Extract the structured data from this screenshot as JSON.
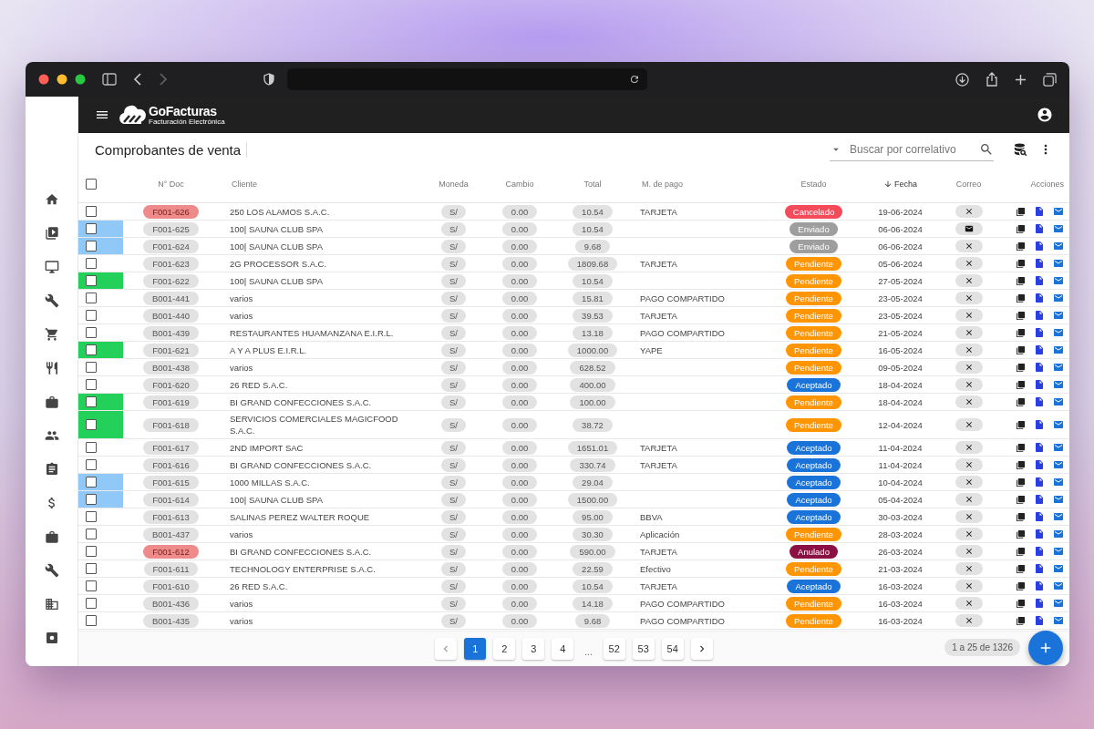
{
  "app": {
    "logo_title": "GoFacturas",
    "logo_subtitle": "Facturación Electrónica"
  },
  "page": {
    "title": "Comprobantes de venta",
    "search": {
      "placeholder": "Buscar por correlativo"
    }
  },
  "table": {
    "columns": [
      "N° Doc",
      "Cliente",
      "Moneda",
      "Cambio",
      "Total",
      "M. de pago",
      "Estado",
      "Fecha",
      "Correo",
      "Acciones"
    ],
    "select_all_checked": false,
    "rows": [
      {
        "doc": "F001-626",
        "checked": false,
        "flagged": true,
        "client": "250 LOS ALAMOS S.A.C.",
        "currency": "S/",
        "rate": "0.00",
        "total": "10.54",
        "payment": "TARJETA",
        "status": {
          "label": "Cancelado",
          "color": "#f44a5a"
        },
        "date": "19-06-2024",
        "email_sent": false
      },
      {
        "doc": "F001-625",
        "checked": false,
        "flagged": false,
        "client": "100| SAUNA CLUB SPA",
        "currency": "S/",
        "rate": "0.00",
        "total": "10.54",
        "status": {
          "label": "Enviado",
          "color": "#9e9e9e"
        },
        "date": "06-06-2024",
        "email_sent": true,
        "color": "#90c8f8"
      },
      {
        "doc": "F001-624",
        "checked": false,
        "flagged": false,
        "client": "100| SAUNA CLUB SPA",
        "currency": "S/",
        "rate": "0.00",
        "total": "9.68",
        "status": {
          "label": "Enviado",
          "color": "#9e9e9e"
        },
        "date": "06-06-2024",
        "email_sent": false,
        "color": "#90c8f8"
      },
      {
        "doc": "F001-623",
        "checked": false,
        "flagged": false,
        "client": "2G PROCESSOR S.A.C.",
        "currency": "S/",
        "rate": "0.00",
        "total": "1809.68",
        "payment": "TARJETA",
        "status": {
          "label": "Pendiente",
          "color": "#ff9500"
        },
        "date": "05-06-2024",
        "email_sent": false
      },
      {
        "doc": "F001-622",
        "checked": false,
        "flagged": false,
        "client": "100| SAUNA CLUB SPA",
        "currency": "S/",
        "rate": "0.00",
        "total": "10.54",
        "status": {
          "label": "Pendiente",
          "color": "#ff9500"
        },
        "date": "27-05-2024",
        "email_sent": false,
        "color": "#22d05a"
      },
      {
        "doc": "B001-441",
        "checked": false,
        "flagged": false,
        "client": "varios",
        "currency": "S/",
        "rate": "0.00",
        "total": "15.81",
        "payment": "PAGO COMPARTIDO",
        "status": {
          "label": "Pendiente",
          "color": "#ff9500"
        },
        "date": "23-05-2024",
        "email_sent": false
      },
      {
        "doc": "B001-440",
        "checked": false,
        "flagged": false,
        "client": "varios",
        "currency": "S/",
        "rate": "0.00",
        "total": "39.53",
        "payment": "TARJETA",
        "status": {
          "label": "Pendiente",
          "color": "#ff9500"
        },
        "date": "23-05-2024",
        "email_sent": false
      },
      {
        "doc": "B001-439",
        "checked": false,
        "flagged": false,
        "client": "RESTAURANTES HUAMANZANA E.I.R.L.",
        "currency": "S/",
        "rate": "0.00",
        "total": "13.18",
        "payment": "PAGO COMPARTIDO",
        "status": {
          "label": "Pendiente",
          "color": "#ff9500"
        },
        "date": "21-05-2024",
        "email_sent": false
      },
      {
        "doc": "F001-621",
        "checked": false,
        "flagged": false,
        "client": "A Y A PLUS E.I.R.L.",
        "currency": "S/",
        "rate": "0.00",
        "total": "1000.00",
        "payment": "YAPE",
        "status": {
          "label": "Pendiente",
          "color": "#ff9500"
        },
        "date": "16-05-2024",
        "email_sent": false,
        "color": "#22d05a"
      },
      {
        "doc": "B001-438",
        "checked": false,
        "flagged": false,
        "client": "varios",
        "currency": "S/",
        "rate": "0.00",
        "total": "628.52",
        "status": {
          "label": "Pendiente",
          "color": "#ff9500"
        },
        "date": "09-05-2024",
        "email_sent": false
      },
      {
        "doc": "F001-620",
        "checked": false,
        "flagged": false,
        "client": "26 RED S.A.C.",
        "currency": "S/",
        "rate": "0.00",
        "total": "400.00",
        "status": {
          "label": "Aceptado",
          "color": "#1a73d8"
        },
        "date": "18-04-2024",
        "email_sent": false
      },
      {
        "doc": "F001-619",
        "checked": false,
        "flagged": false,
        "client": "BI GRAND CONFECCIONES S.A.C.",
        "currency": "S/",
        "rate": "0.00",
        "total": "100.00",
        "status": {
          "label": "Pendiente",
          "color": "#ff9500"
        },
        "date": "18-04-2024",
        "email_sent": false,
        "color": "#22d05a"
      },
      {
        "doc": "F001-618",
        "checked": false,
        "flagged": false,
        "client": "SERVICIOS COMERCIALES MAGICFOOD S.A.C.",
        "currency": "S/",
        "rate": "0.00",
        "total": "38.72",
        "status": {
          "label": "Pendiente",
          "color": "#ff9500"
        },
        "date": "12-04-2024",
        "email_sent": false,
        "color": "#22d05a"
      },
      {
        "doc": "F001-617",
        "checked": false,
        "flagged": false,
        "client": "2ND IMPORT SAC",
        "currency": "S/",
        "rate": "0.00",
        "total": "1651.01",
        "payment": "TARJETA",
        "status": {
          "label": "Aceptado",
          "color": "#1a73d8"
        },
        "date": "11-04-2024",
        "email_sent": false
      },
      {
        "doc": "F001-616",
        "checked": false,
        "flagged": false,
        "client": "BI GRAND CONFECCIONES S.A.C.",
        "currency": "S/",
        "rate": "0.00",
        "total": "330.74",
        "payment": "TARJETA",
        "status": {
          "label": "Aceptado",
          "color": "#1a73d8"
        },
        "date": "11-04-2024",
        "email_sent": false
      },
      {
        "doc": "F001-615",
        "checked": false,
        "flagged": false,
        "client": "1000 MILLAS S.A.C.",
        "currency": "S/",
        "rate": "0.00",
        "total": "29.04",
        "status": {
          "label": "Aceptado",
          "color": "#1a73d8"
        },
        "date": "10-04-2024",
        "email_sent": false,
        "color": "#90c8f8"
      },
      {
        "doc": "F001-614",
        "checked": false,
        "flagged": false,
        "client": "100| SAUNA CLUB SPA",
        "currency": "S/",
        "rate": "0.00",
        "total": "1500.00",
        "status": {
          "label": "Aceptado",
          "color": "#1a73d8"
        },
        "date": "05-04-2024",
        "email_sent": false,
        "color": "#90c8f8"
      },
      {
        "doc": "F001-613",
        "checked": false,
        "flagged": false,
        "client": "SALINAS PEREZ WALTER ROQUE",
        "currency": "S/",
        "rate": "0.00",
        "total": "95.00",
        "payment": "BBVA",
        "status": {
          "label": "Aceptado",
          "color": "#1a73d8"
        },
        "date": "30-03-2024",
        "email_sent": false
      },
      {
        "doc": "B001-437",
        "checked": false,
        "flagged": false,
        "client": "varios",
        "currency": "S/",
        "rate": "0.00",
        "total": "30.30",
        "payment": "Aplicación",
        "status": {
          "label": "Pendiente",
          "color": "#ff9500"
        },
        "date": "28-03-2024",
        "email_sent": false
      },
      {
        "doc": "F001-612",
        "checked": false,
        "flagged": true,
        "client": "BI GRAND CONFECCIONES S.A.C.",
        "currency": "S/",
        "rate": "0.00",
        "total": "590.00",
        "payment": "TARJETA",
        "status": {
          "label": "Anulado",
          "color": "#8b1043"
        },
        "date": "26-03-2024",
        "email_sent": false
      },
      {
        "doc": "F001-611",
        "checked": false,
        "flagged": false,
        "client": "TECHNOLOGY ENTERPRISE S.A.C.",
        "currency": "S/",
        "rate": "0.00",
        "total": "22.59",
        "payment": "Efectivo",
        "status": {
          "label": "Pendiente",
          "color": "#ff9500"
        },
        "date": "21-03-2024",
        "email_sent": false
      },
      {
        "doc": "F001-610",
        "checked": false,
        "flagged": false,
        "client": "26 RED S.A.C.",
        "currency": "S/",
        "rate": "0.00",
        "total": "10.54",
        "payment": "TARJETA",
        "status": {
          "label": "Aceptado",
          "color": "#1a73d8"
        },
        "date": "16-03-2024",
        "email_sent": false
      },
      {
        "doc": "B001-436",
        "checked": false,
        "flagged": false,
        "client": "varios",
        "currency": "S/",
        "rate": "0.00",
        "total": "14.18",
        "payment": "PAGO COMPARTIDO",
        "status": {
          "label": "Pendiente",
          "color": "#ff9500"
        },
        "date": "16-03-2024",
        "email_sent": false
      },
      {
        "doc": "B001-435",
        "checked": false,
        "flagged": false,
        "client": "varios",
        "currency": "S/",
        "rate": "0.00",
        "total": "9.68",
        "payment": "PAGO COMPARTIDO",
        "status": {
          "label": "Pendiente",
          "color": "#ff9500"
        },
        "date": "16-03-2024",
        "email_sent": false
      }
    ]
  },
  "pagination": {
    "pages": [
      {
        "label": "1",
        "selected": true
      },
      {
        "label": "2",
        "selected": false
      },
      {
        "label": "3",
        "selected": false
      },
      {
        "label": "4",
        "selected": false
      },
      {
        "label": "...",
        "kind": "gap"
      },
      {
        "label": "52",
        "selected": false
      },
      {
        "label": "53",
        "selected": false
      },
      {
        "label": "54",
        "selected": false
      }
    ],
    "range": "1 a 25 de 1326"
  }
}
